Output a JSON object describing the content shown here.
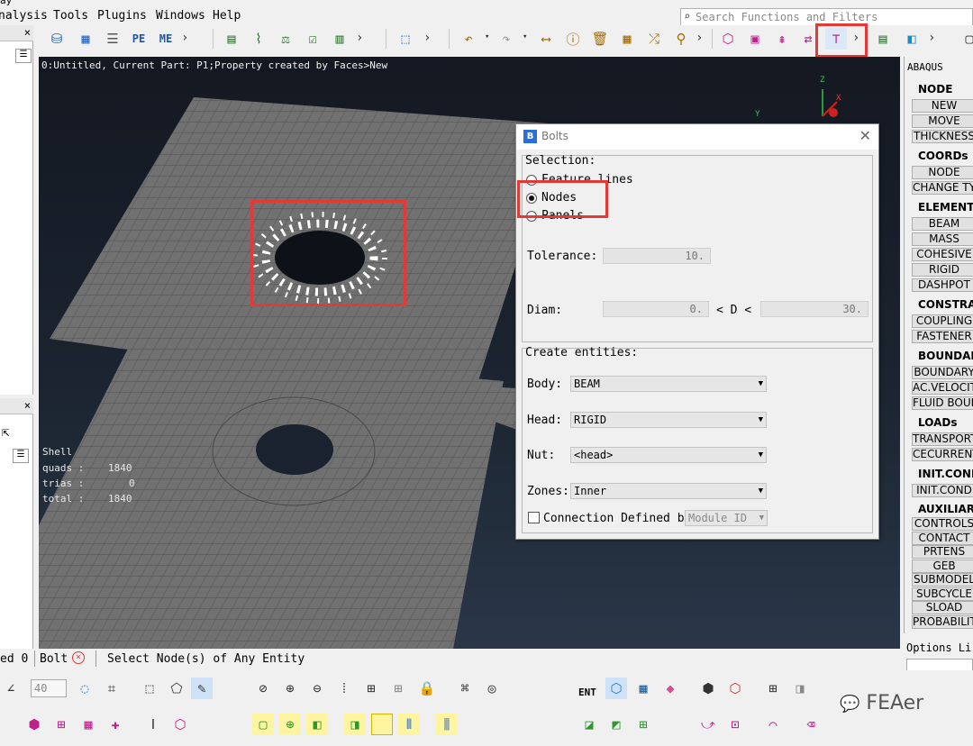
{
  "menu": {
    "fragment": "ay",
    "items": [
      "nalysis",
      "Tools",
      "Plugins",
      "Windows",
      "Help"
    ]
  },
  "search": {
    "placeholder": "Search Functions and Filters"
  },
  "viewport": {
    "status_line": "0:Untitled,  Current Part: P1;Property created by Faces>New",
    "stats": [
      {
        "label": "Shell",
        "value": ""
      },
      {
        "label": "quads :",
        "value": "1840"
      },
      {
        "label": "trias :",
        "value": "0"
      },
      {
        "label": "total :",
        "value": "1840"
      }
    ],
    "axis_labels": {
      "z": "Z",
      "x": "X",
      "y": "Y"
    }
  },
  "dialog": {
    "title": "Bolts",
    "selection_label": "Selection:",
    "options": [
      {
        "label": "Feature lines",
        "selected": false
      },
      {
        "label": "Nodes",
        "selected": true
      },
      {
        "label": "Panels",
        "selected": false
      }
    ],
    "tolerance_label": "Tolerance:",
    "tolerance_value": "10.",
    "diam_label": "Diam:",
    "diam_min": "0.",
    "diam_op": "< D <",
    "diam_max": "30.",
    "create_label": "Create entities:",
    "body_label": "Body:",
    "body_value": "BEAM",
    "head_label": "Head:",
    "head_value": "RIGID",
    "nut_label": "Nut:",
    "nut_value": "<head>",
    "zones_label": "Zones:",
    "zones_value": "Inner",
    "connection_label": "Connection Defined by",
    "connection_value": "Module ID"
  },
  "right_panel": {
    "title": "ABAQUS",
    "sections": [
      {
        "head": "NODE",
        "items": [
          "NEW",
          "MOVE",
          "THICKNESS"
        ]
      },
      {
        "head": "COORDs",
        "items": [
          "NODE",
          "CHANGE TYPE"
        ]
      },
      {
        "head": "ELEMENTS",
        "items": [
          "BEAM",
          "MASS",
          "COHESIVE",
          "RIGID",
          "DASHPOT"
        ]
      },
      {
        "head": "CONSTRAINTS",
        "items": [
          "COUPLING",
          "FASTENER"
        ]
      },
      {
        "head": "BOUNDARY",
        "items": [
          "BOUNDARY",
          "AC.VELOCITY",
          "FLUID BOUNDARY"
        ]
      },
      {
        "head": "LOADs",
        "items": [
          "TRANSPORT",
          "CECURRENT"
        ]
      },
      {
        "head": "INIT.COND",
        "items": [
          "INIT.COND"
        ]
      },
      {
        "head": "AUXILIARY",
        "items": [
          "CONTROLS",
          "CONTACT",
          "PRTENS",
          "GEB",
          "SUBMODEL",
          "SUBCYCLE",
          "SLOAD",
          "PROBABILITY"
        ]
      }
    ],
    "options_label": "Options Li"
  },
  "status_bar": {
    "left": "ed 0",
    "tool": "Bolt",
    "message": "Select Node(s) of Any Entity"
  },
  "bottom_toolbar": {
    "spin_value": "40",
    "ent_label": "ENT"
  },
  "watermark": "FEAer",
  "colors": {
    "highlight": "#e53935",
    "viewport_top": "#141821",
    "mesh": "#6b6b6b"
  }
}
